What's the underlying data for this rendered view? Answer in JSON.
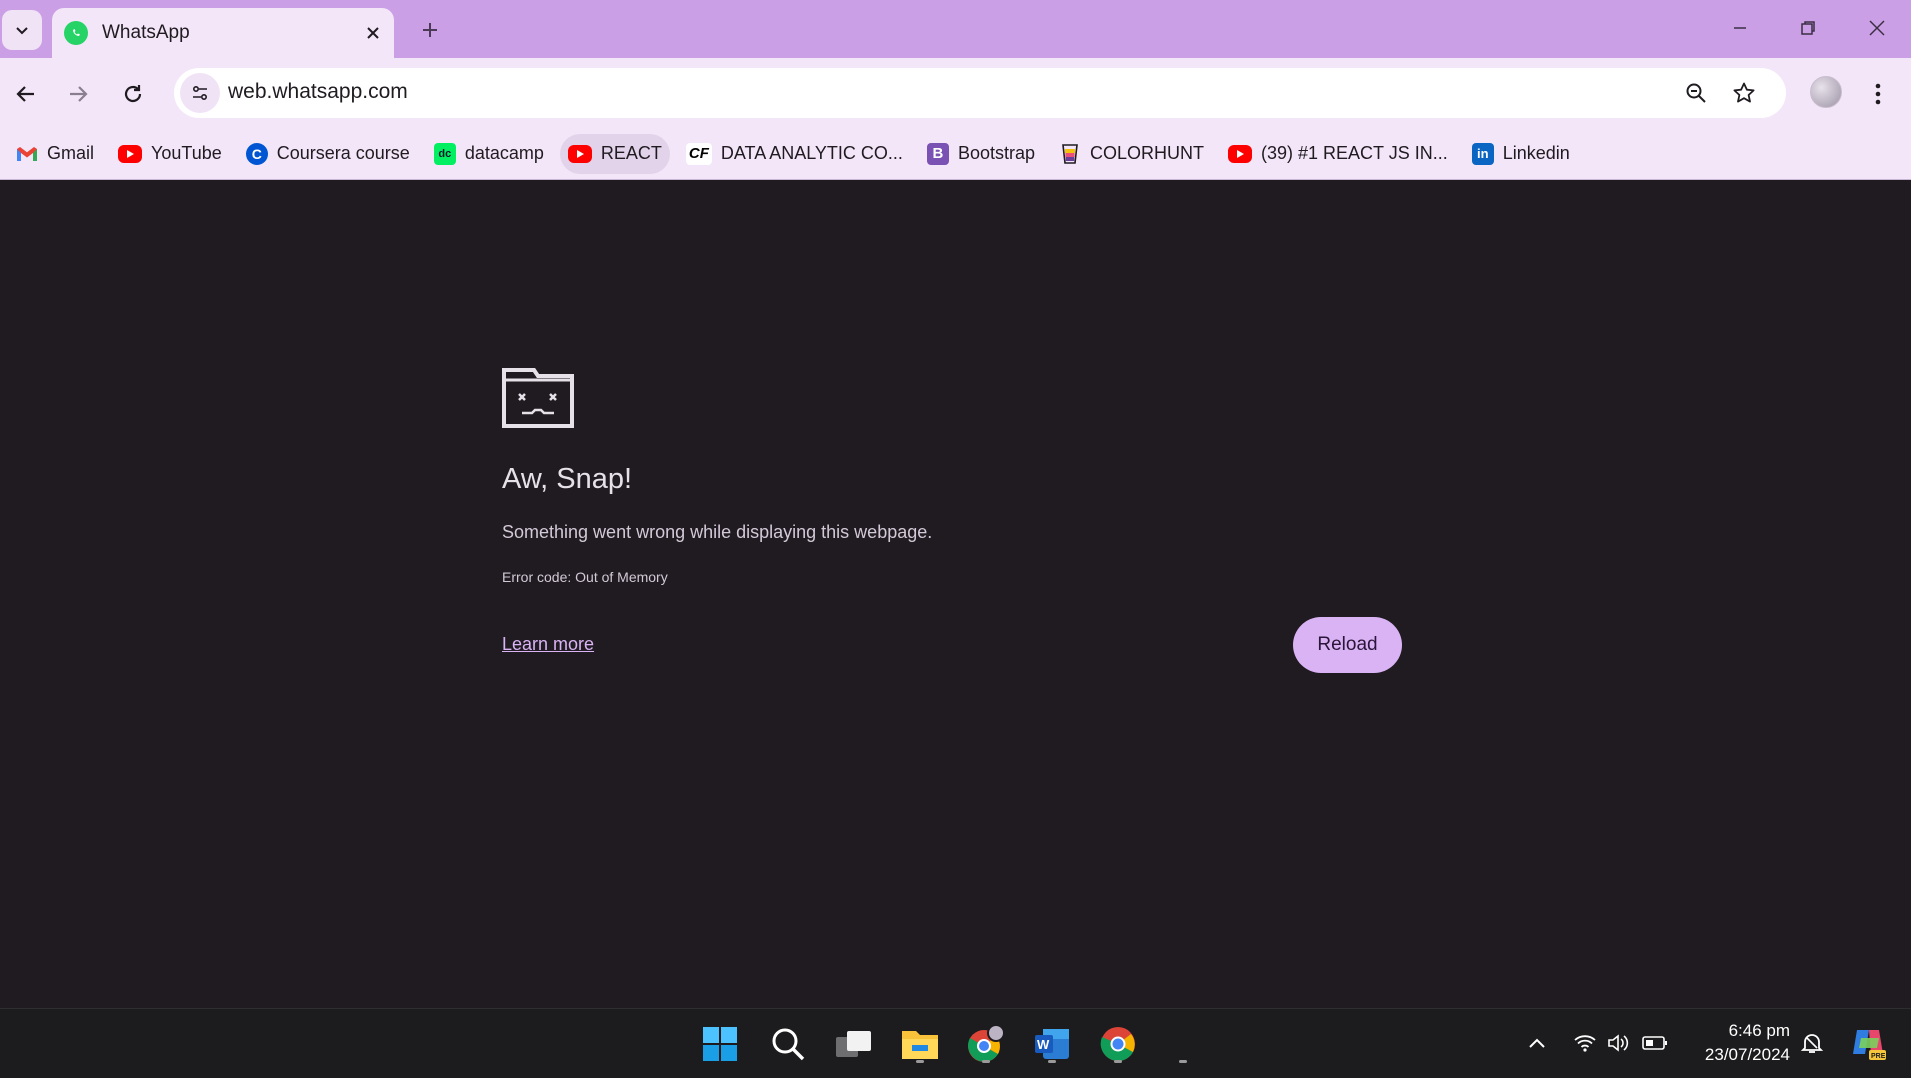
{
  "browser": {
    "tab": {
      "title": "WhatsApp"
    },
    "address_bar": {
      "url": "web.whatsapp.com"
    },
    "bookmarks": [
      {
        "label": "Gmail",
        "icon": "gmail-icon",
        "color": "#ea4335"
      },
      {
        "label": "YouTube",
        "icon": "youtube-icon",
        "color": "#ff0000"
      },
      {
        "label": "Coursera course",
        "icon": "coursera-icon",
        "color": "#0056d2"
      },
      {
        "label": "datacamp",
        "icon": "datacamp-icon",
        "color": "#03ef62"
      },
      {
        "label": "REACT",
        "icon": "youtube-icon",
        "color": "#ff0000"
      },
      {
        "label": "DATA ANALYTIC CO...",
        "icon": "cf-icon",
        "color": "#000000"
      },
      {
        "label": "Bootstrap",
        "icon": "bootstrap-icon",
        "color": "#7952b3"
      },
      {
        "label": "COLORHUNT",
        "icon": "colorhunt-icon",
        "color": "#f4c20d"
      },
      {
        "label": "(39) #1 REACT JS IN...",
        "icon": "youtube-icon",
        "color": "#ff0000"
      },
      {
        "label": "Linkedin",
        "icon": "linkedin-icon",
        "color": "#0a66c2"
      }
    ]
  },
  "error_page": {
    "title": "Aw, Snap!",
    "message": "Something went wrong while displaying this webpage.",
    "error_code": "Error code: Out of Memory",
    "learn_more": "Learn more",
    "reload": "Reload"
  },
  "taskbar": {
    "apps": [
      "start-icon",
      "search-icon",
      "task-view-icon",
      "file-explorer-icon",
      "chrome-profile-icon",
      "word-icon",
      "chrome-icon"
    ],
    "clock": {
      "time": "6:46 pm",
      "date": "23/07/2024"
    }
  },
  "colors": {
    "tabstrip": "#cb9fe6",
    "toolbar": "#f3e6f8",
    "page_bg": "#1f1b20",
    "accent": "#dab3f5"
  }
}
